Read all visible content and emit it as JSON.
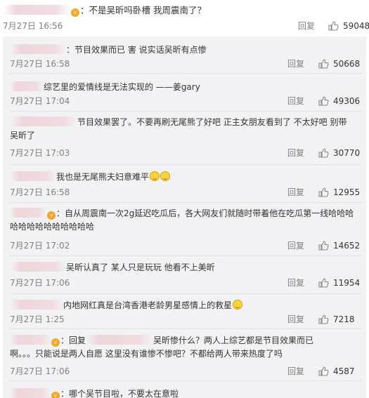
{
  "top_comment": {
    "text": "：不是吴昕吗卧槽 我周震南了？",
    "time": "7月27日 16:56",
    "reply_label": "回复",
    "likes": "59048"
  },
  "replies": [
    {
      "text": "：节目效果而已 害 说实话吴昕有点惨",
      "time": "7月27日 16:58",
      "reply_label": "回复",
      "likes": "50668"
    },
    {
      "text": "综艺里的爱情线是无法实现的 ——姜gary",
      "time": "7月27日 17:04",
      "reply_label": "回复",
      "likes": "49306"
    },
    {
      "text": "节目效果罢了。不要再刷无尾熊了好吧 正主女朋友看到了 不太好吧 别带",
      "text2": "吴昕了",
      "time": "7月27日 17:03",
      "reply_label": "回复",
      "likes": "30770"
    },
    {
      "text": "我也是无尾熊夫妇意难平",
      "time": "7月27日 16:58",
      "reply_label": "回复",
      "likes": "12955"
    },
    {
      "text": "：自从周震南一次2g延迟吃瓜后，各大网友们就随时带着他在吃瓜第一线哈哈哈",
      "text2": "哈哈哈哈哈哈哈哈哈哈",
      "time": "7月27日 17:02",
      "reply_label": "回复",
      "likes": "14652"
    },
    {
      "text": "吴昕认真了  某人只是玩玩 他看不上美昕",
      "time": "7月27日 17:06",
      "reply_label": "回复",
      "likes": "11954"
    },
    {
      "text": "内地网红真是台湾香港老龄男星感情上的救星",
      "time": "7月27日 1:25",
      "reply_label": "回复",
      "likes": "7218"
    },
    {
      "text": "：回复",
      "text_b": "吴昕惨什么？两人上综艺都是节目效果而已",
      "text2": "啊。。。只能说是两人自愿 这里没有谁惨不惨吧？不都给两人带来热度了吗",
      "time": "7月27日 17:06",
      "reply_label": "回复",
      "likes": "4587"
    },
    {
      "text": "：哪个吴节目啦，不要太在意啦",
      "time": "",
      "reply_label": "",
      "likes": ""
    }
  ],
  "icons": {
    "like": "thumbs-up-icon",
    "verified": "verified-badge-icon",
    "emoji": "smile-emoji-icon"
  },
  "colors": {
    "panel_bg": "#f2f2f5",
    "muted": "#808080",
    "badge": "#f5a623"
  }
}
